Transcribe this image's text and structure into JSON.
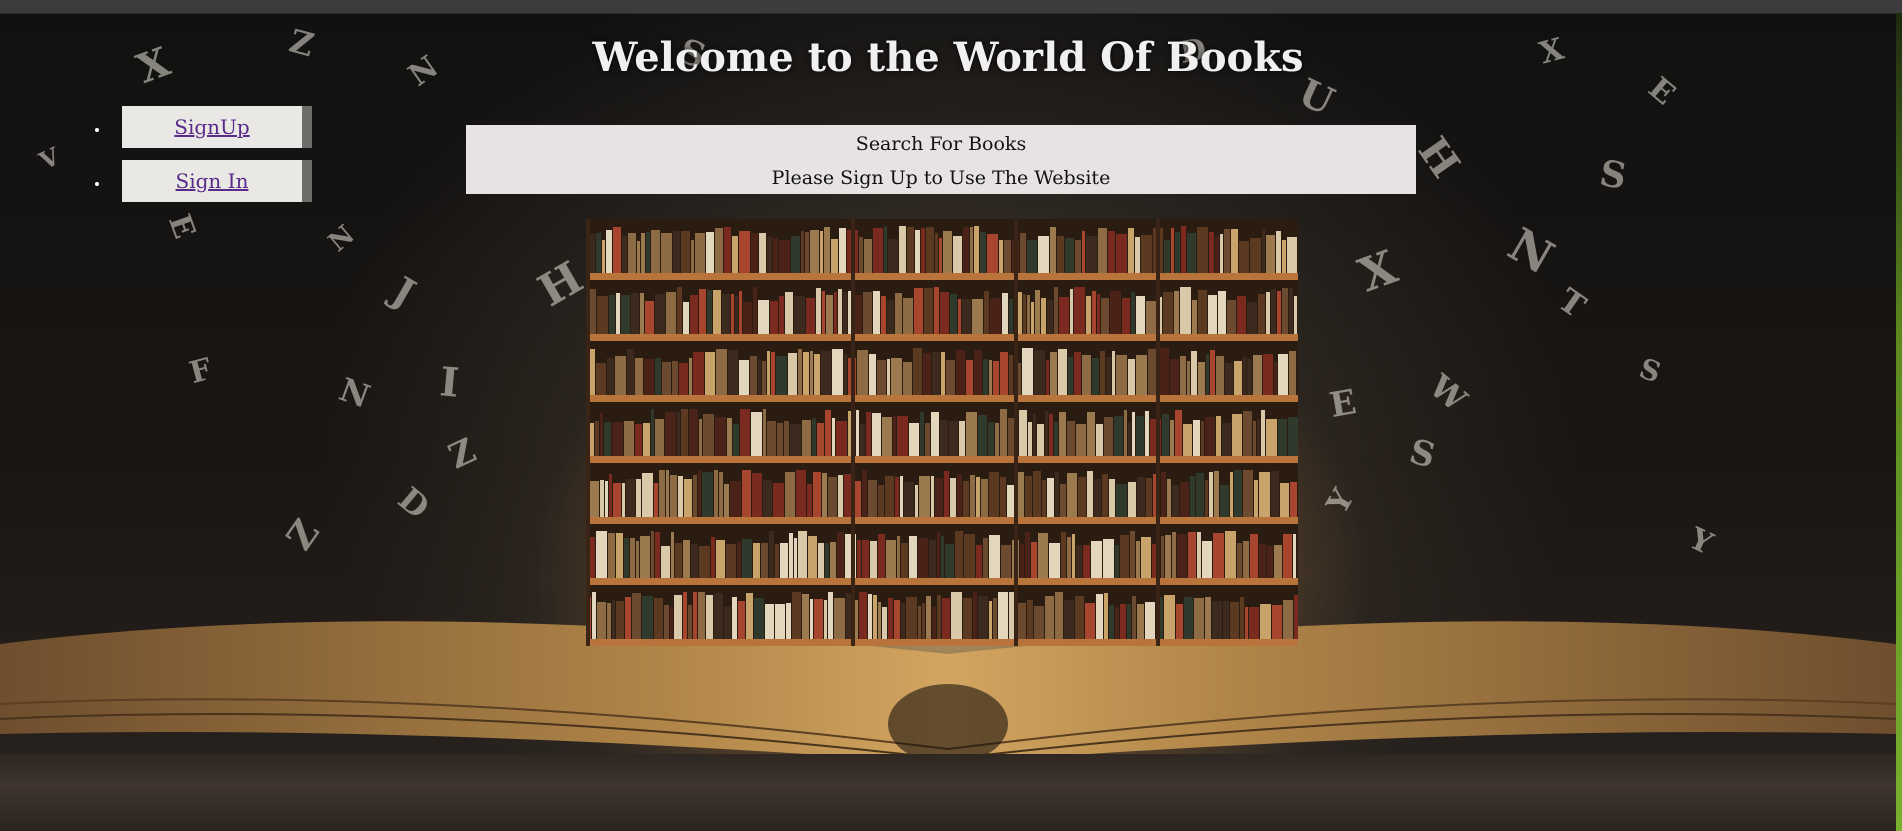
{
  "page": {
    "title": "Welcome to the World Of Books"
  },
  "nav": {
    "items": [
      {
        "label": "SignUp"
      },
      {
        "label": "Sign In"
      }
    ]
  },
  "search_panel": {
    "heading": "Search For Books",
    "notice": "Please Sign Up to Use The Website"
  },
  "colors": {
    "panel_bg": "#e6e3e2",
    "nav_button_bg": "#e9e8e4",
    "link_color": "#5a2a8a",
    "title_color": "#f1efef"
  }
}
